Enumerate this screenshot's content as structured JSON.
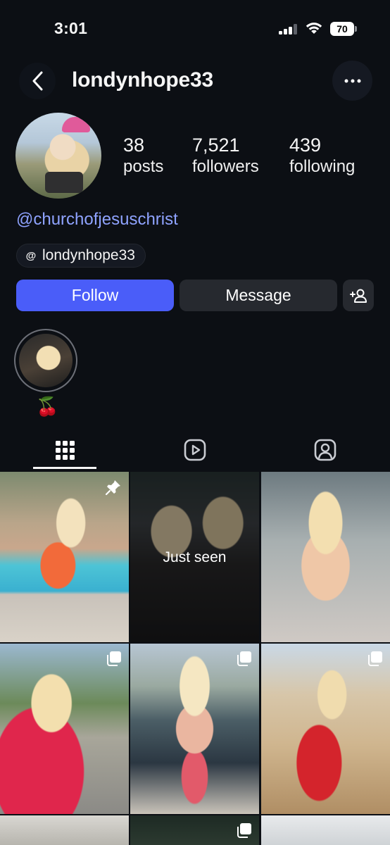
{
  "status_bar": {
    "time": "3:01",
    "battery": "70"
  },
  "header": {
    "username": "londynhope33"
  },
  "profile": {
    "stats": [
      {
        "value": "38",
        "label": "posts"
      },
      {
        "value": "7,521",
        "label": "followers"
      },
      {
        "value": "439",
        "label": "following"
      }
    ],
    "bio_link": "@churchofjesuschrist",
    "threads_handle": "londynhope33",
    "threads_icon": "@"
  },
  "actions": {
    "follow_label": "Follow",
    "message_label": "Message"
  },
  "highlights": [
    {
      "label": "🍒"
    }
  ],
  "tabs": [
    {
      "name": "posts-grid-icon",
      "active": true
    },
    {
      "name": "reels-icon",
      "active": false
    },
    {
      "name": "tagged-icon",
      "active": false
    }
  ],
  "grid": {
    "posts": [
      {
        "overlay": "pin-icon",
        "text": ""
      },
      {
        "overlay": "",
        "text": "Just seen"
      },
      {
        "overlay": "",
        "text": ""
      },
      {
        "overlay": "carousel-icon",
        "text": ""
      },
      {
        "overlay": "carousel-icon",
        "text": ""
      },
      {
        "overlay": "carousel-icon",
        "text": ""
      },
      {
        "overlay": "",
        "text": ""
      },
      {
        "overlay": "carousel-icon",
        "text": ""
      },
      {
        "overlay": "",
        "text": ""
      }
    ]
  },
  "colors": {
    "background": "#0c0f14",
    "accent": "#4a5df9",
    "link": "#8fa3ff",
    "secondary_button": "#26292f"
  }
}
